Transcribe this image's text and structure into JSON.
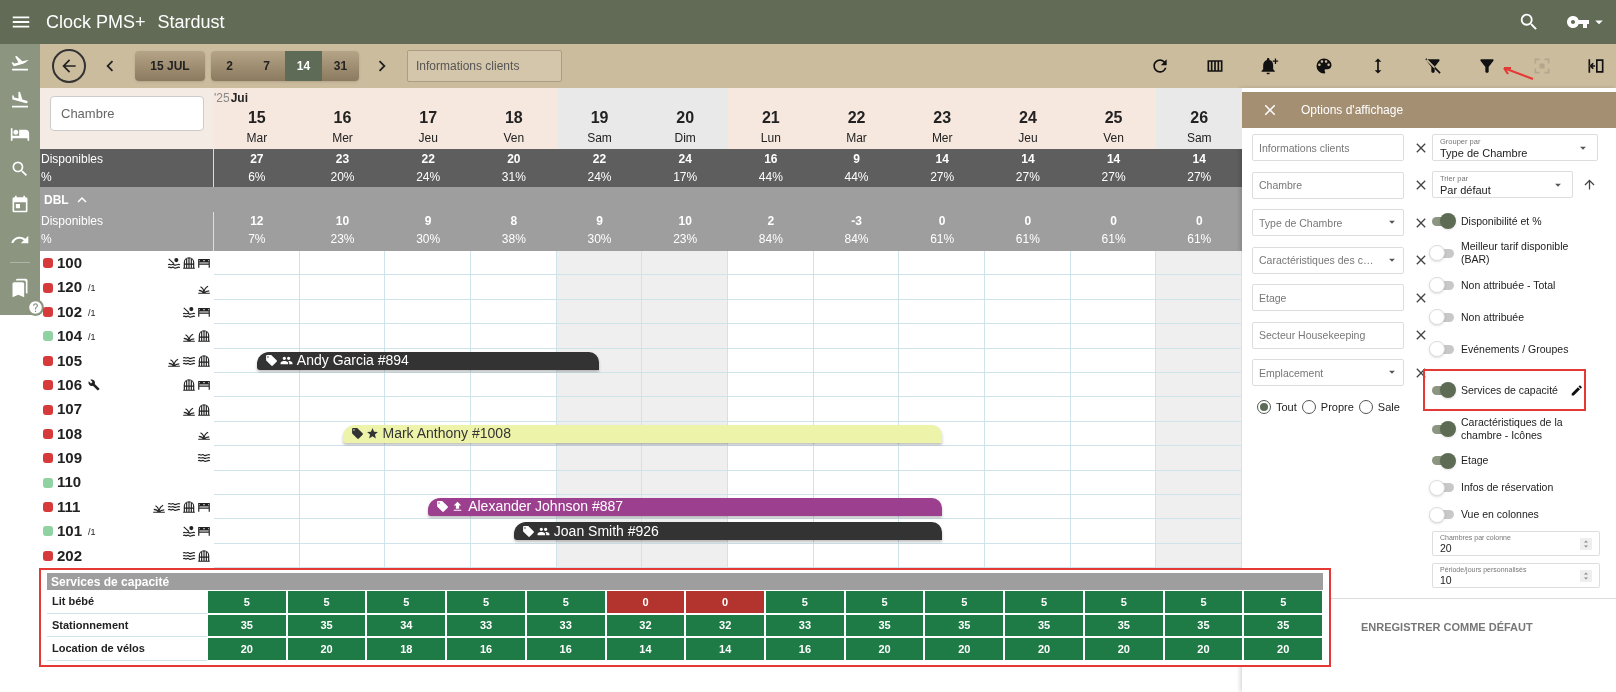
{
  "app_bar": {
    "title": "Clock PMS+",
    "property": "Stardust"
  },
  "toolbar": {
    "date_button": "15 JUL",
    "ranges": [
      {
        "label": "2",
        "selected": false
      },
      {
        "label": "7",
        "selected": false
      },
      {
        "label": "14",
        "selected": true
      },
      {
        "label": "31",
        "selected": false
      }
    ],
    "search": {
      "placeholder": "Informations clients"
    },
    "actions": [
      {
        "kind": "refresh",
        "disabled": false,
        "annotated": false
      },
      {
        "kind": "columns",
        "disabled": false,
        "annotated": false
      },
      {
        "kind": "bell-plus",
        "disabled": false,
        "annotated": false
      },
      {
        "kind": "palette",
        "disabled": false,
        "annotated": false
      },
      {
        "kind": "height",
        "disabled": false,
        "annotated": false
      },
      {
        "kind": "filter-off",
        "disabled": false,
        "annotated": false
      },
      {
        "kind": "filter",
        "disabled": false,
        "annotated": true
      },
      {
        "kind": "focus",
        "disabled": true,
        "annotated": false
      },
      {
        "kind": "collapse",
        "disabled": false,
        "annotated": false
      }
    ]
  },
  "calendar": {
    "room_search": {
      "placeholder": "Chambre"
    },
    "year": "'25",
    "month": "Jui",
    "days": [
      {
        "day": "15",
        "weekday": "Mar",
        "weekend": false
      },
      {
        "day": "16",
        "weekday": "Mer",
        "weekend": false
      },
      {
        "day": "17",
        "weekday": "Jeu",
        "weekend": false
      },
      {
        "day": "18",
        "weekday": "Ven",
        "weekend": false
      },
      {
        "day": "19",
        "weekday": "Sam",
        "weekend": true
      },
      {
        "day": "20",
        "weekday": "Dim",
        "weekend": true
      },
      {
        "day": "21",
        "weekday": "Lun",
        "weekend": false
      },
      {
        "day": "22",
        "weekday": "Mar",
        "weekend": false
      },
      {
        "day": "23",
        "weekday": "Mer",
        "weekend": false
      },
      {
        "day": "24",
        "weekday": "Jeu",
        "weekend": false
      },
      {
        "day": "25",
        "weekday": "Ven",
        "weekend": false
      },
      {
        "day": "26",
        "weekday": "Sam",
        "weekend": true
      }
    ],
    "totals": {
      "available_label": "Disponibles",
      "percent_label": "%",
      "values": [
        {
          "available": "27",
          "percent": "6%"
        },
        {
          "available": "23",
          "percent": "20%"
        },
        {
          "available": "22",
          "percent": "24%"
        },
        {
          "available": "20",
          "percent": "31%"
        },
        {
          "available": "22",
          "percent": "24%"
        },
        {
          "available": "24",
          "percent": "17%"
        },
        {
          "available": "16",
          "percent": "44%"
        },
        {
          "available": "9",
          "percent": "44%"
        },
        {
          "available": "14",
          "percent": "27%"
        },
        {
          "available": "14",
          "percent": "27%"
        },
        {
          "available": "14",
          "percent": "27%"
        },
        {
          "available": "14",
          "percent": "27%"
        }
      ]
    },
    "groups": [
      {
        "name": "DBL",
        "expanded": true,
        "available_label": "Disponibles",
        "percent_label": "%",
        "values": [
          {
            "available": "12",
            "percent": "7%"
          },
          {
            "available": "10",
            "percent": "23%"
          },
          {
            "available": "9",
            "percent": "30%"
          },
          {
            "available": "8",
            "percent": "38%"
          },
          {
            "available": "9",
            "percent": "30%"
          },
          {
            "available": "10",
            "percent": "23%"
          },
          {
            "available": "2",
            "percent": "84%"
          },
          {
            "available": "-3",
            "percent": "84%"
          },
          {
            "available": "0",
            "percent": "61%"
          },
          {
            "available": "0",
            "percent": "61%"
          },
          {
            "available": "0",
            "percent": "61%"
          },
          {
            "available": "0",
            "percent": "61%"
          }
        ],
        "rooms": [
          {
            "number": "100",
            "color": "#d63a3a",
            "maintenance": false,
            "features": [
              {
                "kind": "beach"
              },
              {
                "kind": "dome"
              },
              {
                "kind": "bed"
              }
            ]
          },
          {
            "number": "120",
            "floor": "/1",
            "color": "#d63a3a",
            "maintenance": false,
            "features": [
              {
                "kind": "plant"
              }
            ]
          },
          {
            "number": "102",
            "floor": "/1",
            "color": "#d63a3a",
            "maintenance": false,
            "features": [
              {
                "kind": "beach"
              },
              {
                "kind": "bed"
              }
            ]
          },
          {
            "number": "104",
            "floor": "/1",
            "color": "#90d2a2",
            "maintenance": false,
            "features": [
              {
                "kind": "plant"
              },
              {
                "kind": "dome"
              }
            ]
          },
          {
            "number": "105",
            "color": "#d63a3a",
            "maintenance": false,
            "features": [
              {
                "kind": "plant"
              },
              {
                "kind": "waves"
              },
              {
                "kind": "dome"
              }
            ],
            "bookings": [
              {
                "guest": "Andy Garcia #894",
                "kind": "group",
                "color": "#333333",
                "nights": [
                  true,
                  true,
                  true,
                  true,
                  false,
                  false,
                  false,
                  false,
                  false,
                  false,
                  false,
                  false
                ]
              }
            ]
          },
          {
            "number": "106",
            "color": "#d63a3a",
            "maintenance": true,
            "features": [
              {
                "kind": "dome"
              },
              {
                "kind": "bed"
              }
            ]
          },
          {
            "number": "107",
            "color": "#d63a3a",
            "maintenance": false,
            "features": [
              {
                "kind": "plant"
              },
              {
                "kind": "dome"
              }
            ]
          },
          {
            "number": "108",
            "color": "#d63a3a",
            "maintenance": false,
            "features": [
              {
                "kind": "plant"
              }
            ],
            "bookings": [
              {
                "guest": "Mark Anthony #1008",
                "kind": "vip",
                "color": "#eef3aa",
                "nights": [
                  false,
                  true,
                  true,
                  true,
                  true,
                  true,
                  true,
                  true,
                  false,
                  false,
                  false,
                  false
                ]
              }
            ]
          },
          {
            "number": "109",
            "color": "#d63a3a",
            "maintenance": false,
            "features": [
              {
                "kind": "waves"
              }
            ]
          },
          {
            "number": "110",
            "color": "#90d2a2",
            "maintenance": false
          },
          {
            "number": "111",
            "color": "#d63a3a",
            "maintenance": false,
            "features": [
              {
                "kind": "plant"
              },
              {
                "kind": "waves"
              },
              {
                "kind": "dome"
              },
              {
                "kind": "bed"
              }
            ],
            "bookings": [
              {
                "guest": "Alexander Johnson #887",
                "kind": "upgrade",
                "color": "#9c3f8e",
                "nights": [
                  false,
                  false,
                  true,
                  true,
                  true,
                  true,
                  true,
                  true,
                  false,
                  false,
                  false,
                  false
                ]
              }
            ]
          },
          {
            "number": "101",
            "floor": "/1",
            "color": "#90d2a2",
            "maintenance": false,
            "features": [
              {
                "kind": "beach"
              },
              {
                "kind": "bed"
              }
            ],
            "bookings": [
              {
                "guest": "Joan Smith #926",
                "kind": "group",
                "color": "#333333",
                "nights": [
                  false,
                  false,
                  false,
                  true,
                  true,
                  true,
                  true,
                  true,
                  false,
                  false,
                  false,
                  false
                ]
              }
            ]
          },
          {
            "number": "202",
            "color": "#d63a3a",
            "maintenance": false,
            "features": [
              {
                "kind": "waves"
              },
              {
                "kind": "dome"
              }
            ]
          }
        ]
      }
    ]
  },
  "capacity_services": {
    "title": "Services de capacité",
    "annotated": true,
    "rows": [
      {
        "name": "Lit bébé",
        "values": [
          {
            "value": "5",
            "color": "#1e7b46"
          },
          {
            "value": "5",
            "color": "#1e7b46"
          },
          {
            "value": "5",
            "color": "#1e7b46"
          },
          {
            "value": "5",
            "color": "#1e7b46"
          },
          {
            "value": "5",
            "color": "#1e7b46"
          },
          {
            "value": "0",
            "color": "#b3342e"
          },
          {
            "value": "0",
            "color": "#b3342e"
          },
          {
            "value": "5",
            "color": "#1e7b46"
          },
          {
            "value": "5",
            "color": "#1e7b46"
          },
          {
            "value": "5",
            "color": "#1e7b46"
          },
          {
            "value": "5",
            "color": "#1e7b46"
          },
          {
            "value": "5",
            "color": "#1e7b46"
          },
          {
            "value": "5",
            "color": "#1e7b46"
          },
          {
            "value": "5",
            "color": "#1e7b46"
          }
        ]
      },
      {
        "name": "Stationnement",
        "values": [
          {
            "value": "35",
            "color": "#1e7b46"
          },
          {
            "value": "35",
            "color": "#1e7b46"
          },
          {
            "value": "34",
            "color": "#1e7b46"
          },
          {
            "value": "33",
            "color": "#1e7b46"
          },
          {
            "value": "33",
            "color": "#1e7b46"
          },
          {
            "value": "32",
            "color": "#1e7b46"
          },
          {
            "value": "32",
            "color": "#1e7b46"
          },
          {
            "value": "33",
            "color": "#1e7b46"
          },
          {
            "value": "35",
            "color": "#1e7b46"
          },
          {
            "value": "35",
            "color": "#1e7b46"
          },
          {
            "value": "35",
            "color": "#1e7b46"
          },
          {
            "value": "35",
            "color": "#1e7b46"
          },
          {
            "value": "35",
            "color": "#1e7b46"
          },
          {
            "value": "35",
            "color": "#1e7b46"
          }
        ]
      },
      {
        "name": "Location de vélos",
        "values": [
          {
            "value": "20",
            "color": "#1e7b46"
          },
          {
            "value": "20",
            "color": "#1e7b46"
          },
          {
            "value": "18",
            "color": "#1e7b46"
          },
          {
            "value": "16",
            "color": "#1e7b46"
          },
          {
            "value": "16",
            "color": "#1e7b46"
          },
          {
            "value": "14",
            "color": "#1e7b46"
          },
          {
            "value": "14",
            "color": "#1e7b46"
          },
          {
            "value": "16",
            "color": "#1e7b46"
          },
          {
            "value": "20",
            "color": "#1e7b46"
          },
          {
            "value": "20",
            "color": "#1e7b46"
          },
          {
            "value": "20",
            "color": "#1e7b46"
          },
          {
            "value": "20",
            "color": "#1e7b46"
          },
          {
            "value": "20",
            "color": "#1e7b46"
          },
          {
            "value": "20",
            "color": "#1e7b46"
          }
        ]
      }
    ]
  },
  "display_options": {
    "title": "Options d'affichage",
    "filters": [
      {
        "placeholder": "Informations clients",
        "kind": "text"
      },
      {
        "placeholder": "Chambre",
        "kind": "text"
      },
      {
        "placeholder": "Type de Chambre",
        "kind": "select"
      },
      {
        "placeholder": "Caractéristiques des c…",
        "kind": "select"
      },
      {
        "placeholder": "Etage",
        "kind": "text"
      },
      {
        "placeholder": "Secteur Housekeeping",
        "kind": "text"
      },
      {
        "placeholder": "Emplacement",
        "kind": "select"
      }
    ],
    "cleanliness": [
      {
        "label": "Tout",
        "selected": true
      },
      {
        "label": "Propre",
        "selected": false
      },
      {
        "label": "Sale",
        "selected": false
      }
    ],
    "group_by": {
      "label": "Grouper par",
      "value": "Type de Chambre"
    },
    "sort_by": {
      "label": "Trier par",
      "value": "Par défaut"
    },
    "toggles": [
      {
        "label": "Disponibilité et %",
        "on": true
      },
      {
        "label": "Meilleur tarif disponible (BAR)",
        "on": false
      },
      {
        "label": "Non attribuée - Total",
        "on": false
      },
      {
        "label": "Non attribuée",
        "on": false
      },
      {
        "label": "Evénements / Groupes",
        "on": false
      },
      {
        "label": "Services de capacité",
        "on": true,
        "editable": true,
        "annotated": true
      },
      {
        "label": "Caractéristiques de la chambre - Icônes",
        "on": true
      },
      {
        "label": "Etage",
        "on": true
      },
      {
        "label": "Infos de réservation",
        "on": false
      },
      {
        "label": "Vue en colonnes",
        "on": false
      }
    ],
    "numbers": [
      {
        "label": "Chambres par colonne",
        "value": "20"
      },
      {
        "label": "Période/jours personnalisés",
        "value": "10"
      }
    ],
    "save_button": "ENREGISTRER COMME DÉFAUT"
  }
}
